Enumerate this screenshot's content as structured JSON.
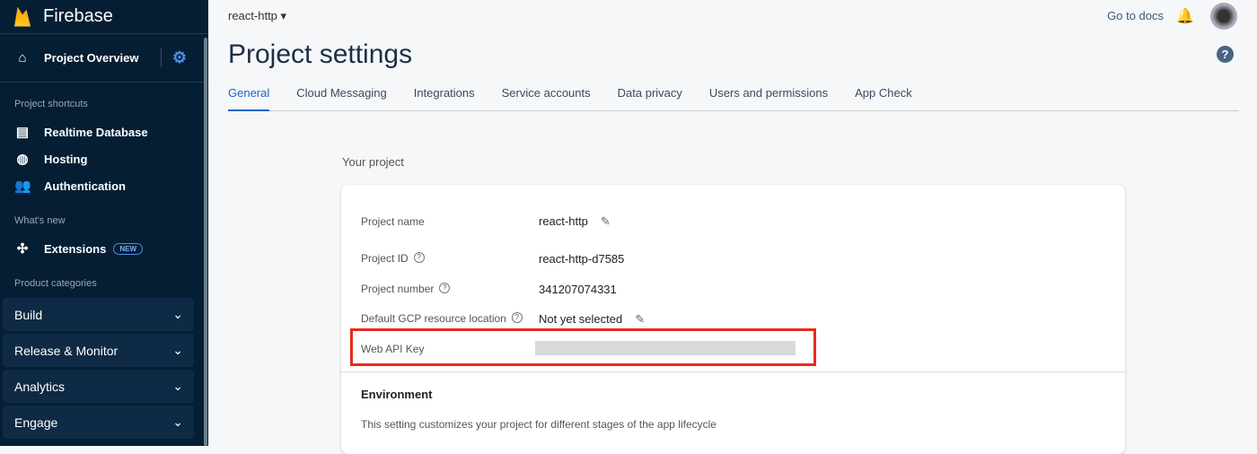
{
  "sidebar": {
    "brand": "Firebase",
    "overview": "Project Overview",
    "shortcuts_title": "Project shortcuts",
    "shortcuts": [
      "Realtime Database",
      "Hosting",
      "Authentication"
    ],
    "whats_new_title": "What's new",
    "extensions": "Extensions",
    "new_badge": "NEW",
    "categories_title": "Product categories",
    "categories": [
      "Build",
      "Release & Monitor",
      "Analytics",
      "Engage"
    ]
  },
  "header": {
    "project": "react-http",
    "docs": "Go to docs",
    "title": "Project settings"
  },
  "tabs": [
    "General",
    "Cloud Messaging",
    "Integrations",
    "Service accounts",
    "Data privacy",
    "Users and permissions",
    "App Check"
  ],
  "section": "Your project",
  "fields": {
    "name_label": "Project name",
    "name": "react-http",
    "id_label": "Project ID",
    "id": "react-http-d7585",
    "number_label": "Project number",
    "number": "341207074331",
    "loc_label": "Default GCP resource location",
    "loc": "Not yet selected",
    "key_label": "Web API Key"
  },
  "env": {
    "title": "Environment",
    "desc": "This setting customizes your project for different stages of the app lifecycle"
  }
}
